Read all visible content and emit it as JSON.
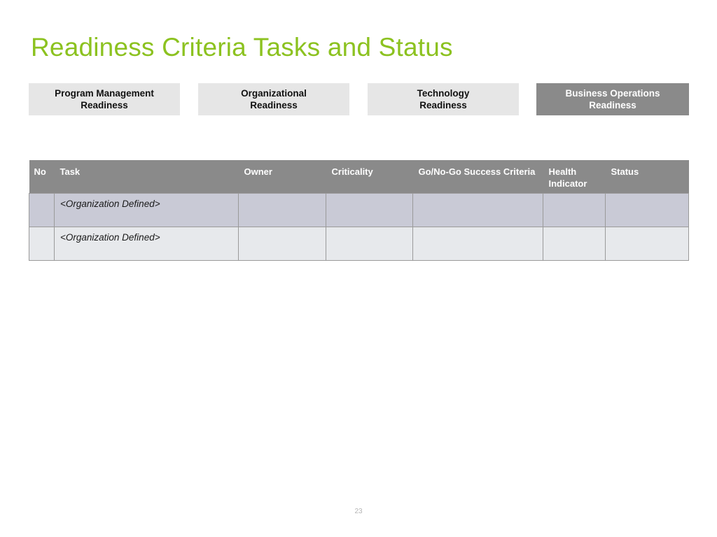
{
  "slide": {
    "title": "Readiness Criteria Tasks and Status",
    "title_color": "#8cc220",
    "page_number": "23",
    "background_color": "#ffffff"
  },
  "tabs": {
    "active_index": 3,
    "active_background": "#8a8a8a",
    "inactive_background": "#e6e6e6",
    "items": [
      {
        "label": "Program Management\nReadiness",
        "active": false
      },
      {
        "label": "Organizational\nReadiness",
        "active": false
      },
      {
        "label": "Technology\nReadiness",
        "active": false
      },
      {
        "label": "Business Operations\nReadiness",
        "active": true
      }
    ]
  },
  "table": {
    "header_background": "#8a8a8a",
    "header_text_color": "#ffffff",
    "row_odd_background": "#c9cad6",
    "row_even_background": "#e7e9ec",
    "border_color": "#9a9a9a",
    "columns": [
      {
        "key": "no",
        "label": "No"
      },
      {
        "key": "task",
        "label": "Task"
      },
      {
        "key": "owner",
        "label": "Owner"
      },
      {
        "key": "criticality",
        "label": "Criticality"
      },
      {
        "key": "criteria",
        "label": "Go/No-Go Success Criteria"
      },
      {
        "key": "health",
        "label": "Health Indicator"
      },
      {
        "key": "status",
        "label": "Status"
      }
    ],
    "rows": [
      {
        "no": "",
        "task": "<Organization Defined>",
        "owner": "",
        "criticality": "",
        "criteria": "",
        "health": "",
        "status": ""
      },
      {
        "no": "",
        "task": "<Organization Defined>",
        "owner": "",
        "criticality": "",
        "criteria": "",
        "health": "",
        "status": ""
      }
    ]
  }
}
